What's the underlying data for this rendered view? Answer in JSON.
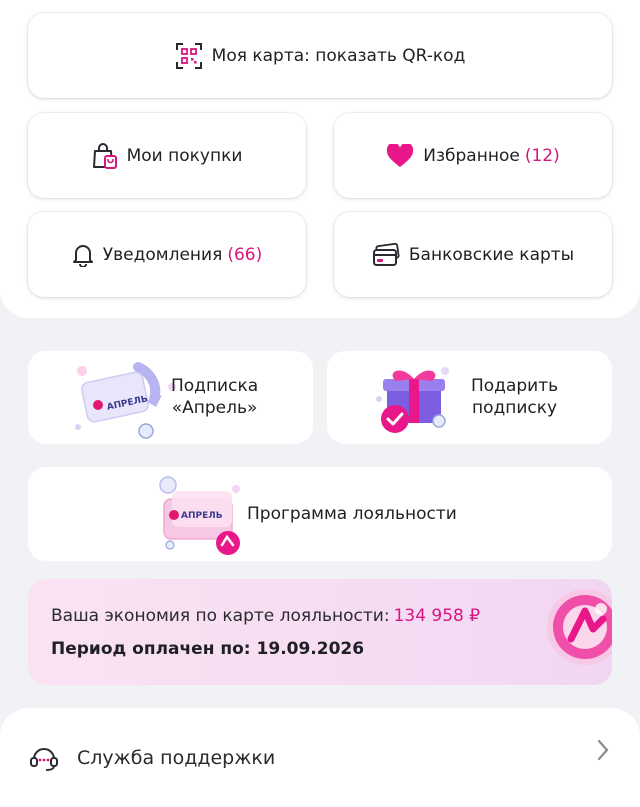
{
  "menu": {
    "qr_card": {
      "label": "Моя карта: показать QR-код",
      "icon": "qr-code-icon"
    },
    "purchases": {
      "label": "Мои покупки",
      "icon": "shopping-bag-icon"
    },
    "favorites": {
      "label": "Избранное",
      "count": "(12)",
      "icon": "heart-icon"
    },
    "notifications": {
      "label": "Уведомления",
      "count": "(66)",
      "icon": "bell-icon"
    },
    "bank_cards": {
      "label": "Банковские карты",
      "icon": "credit-card-icon"
    }
  },
  "cards": {
    "subscription": {
      "line1": "Подписка",
      "line2": "«Апрель»",
      "badge_text": "АПРЕЛЬ"
    },
    "gift": {
      "line1": "Подарить",
      "line2": "подписку"
    },
    "loyalty": {
      "label": "Программа лояльности",
      "badge_text": "АПРЕЛЬ"
    }
  },
  "savings": {
    "text": "Ваша экономия по карте лояльности:",
    "amount": "134 958 ₽",
    "period_label": "Период оплачен по:",
    "period_date": "19.09.2026"
  },
  "support": {
    "label": "Служба поддержки",
    "icon": "support-headset-icon"
  },
  "colors": {
    "accent": "#d6167f",
    "background": "#f1f2f6",
    "savings_bg": "#f7def3"
  }
}
